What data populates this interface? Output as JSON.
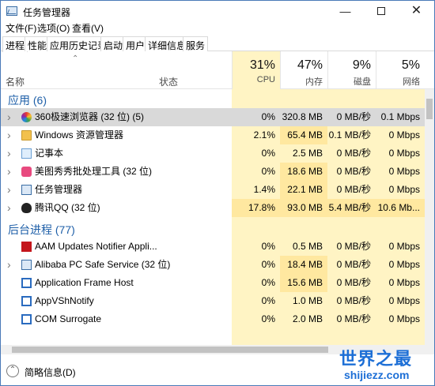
{
  "window": {
    "title": "任务管理器"
  },
  "menu": [
    "文件(F)",
    "选项(O)",
    "查看(V)"
  ],
  "tabs": [
    "进程",
    "性能",
    "应用历史记录",
    "启动",
    "用户",
    "详细信息",
    "服务"
  ],
  "active_tab": 0,
  "header": {
    "name_label": "名称",
    "status_label": "状态",
    "columns": [
      {
        "pct": "31%",
        "label": "CPU"
      },
      {
        "pct": "47%",
        "label": "内存"
      },
      {
        "pct": "9%",
        "label": "磁盘"
      },
      {
        "pct": "5%",
        "label": "网络"
      }
    ]
  },
  "groups": [
    {
      "title": "应用 (6)",
      "rows": [
        {
          "name": "360极速浏览器 (32 位) (5)",
          "cpu": "0%",
          "mem": "320.8 MB",
          "disk": "0 MB/秒",
          "net": "0.1 Mbps",
          "expandable": true,
          "icon": "browser-icon",
          "selected": true
        },
        {
          "name": "Windows 资源管理器",
          "cpu": "2.1%",
          "mem": "65.4 MB",
          "disk": "0.1 MB/秒",
          "net": "0 Mbps",
          "expandable": true,
          "icon": "folder-icon"
        },
        {
          "name": "记事本",
          "cpu": "0%",
          "mem": "2.5 MB",
          "disk": "0 MB/秒",
          "net": "0 Mbps",
          "expandable": true,
          "icon": "notepad-icon"
        },
        {
          "name": "美图秀秀批处理工具 (32 位)",
          "cpu": "0%",
          "mem": "18.6 MB",
          "disk": "0 MB/秒",
          "net": "0 Mbps",
          "expandable": true,
          "icon": "image-tool-icon"
        },
        {
          "name": "任务管理器",
          "cpu": "1.4%",
          "mem": "22.1 MB",
          "disk": "0 MB/秒",
          "net": "0 Mbps",
          "expandable": true,
          "icon": "task-manager-icon"
        },
        {
          "name": "腾讯QQ (32 位)",
          "cpu": "17.8%",
          "mem": "93.0 MB",
          "disk": "5.4 MB/秒",
          "net": "10.6 Mb...",
          "expandable": true,
          "icon": "qq-penguin-icon"
        }
      ]
    },
    {
      "title": "后台进程 (77)",
      "rows": [
        {
          "name": "AAM Updates Notifier Appli...",
          "cpu": "0%",
          "mem": "0.5 MB",
          "disk": "0 MB/秒",
          "net": "0 Mbps",
          "expandable": false,
          "icon": "adobe-icon"
        },
        {
          "name": "Alibaba PC Safe Service (32 位)",
          "cpu": "0%",
          "mem": "18.4 MB",
          "disk": "0 MB/秒",
          "net": "0 Mbps",
          "expandable": true,
          "icon": "service-icon"
        },
        {
          "name": "Application Frame Host",
          "cpu": "0%",
          "mem": "15.6 MB",
          "disk": "0 MB/秒",
          "net": "0 Mbps",
          "expandable": false,
          "icon": "app-frame-icon"
        },
        {
          "name": "AppVShNotify",
          "cpu": "0%",
          "mem": "1.0 MB",
          "disk": "0 MB/秒",
          "net": "0 Mbps",
          "expandable": false,
          "icon": "app-frame-icon"
        },
        {
          "name": "COM Surrogate",
          "cpu": "0%",
          "mem": "2.0 MB",
          "disk": "0 MB/秒",
          "net": "0 Mbps",
          "expandable": false,
          "icon": "app-frame-icon"
        }
      ]
    }
  ],
  "footer": {
    "fewer_details": "简略信息(D)"
  },
  "watermark": {
    "line1": "世界之最",
    "line2": "shijiezz.com"
  },
  "colors": {
    "accent": "#1e5fa8",
    "heat_light": "#fff4c4",
    "heat_strong": "#ffe8a0",
    "selected": "#d9d9d9"
  }
}
